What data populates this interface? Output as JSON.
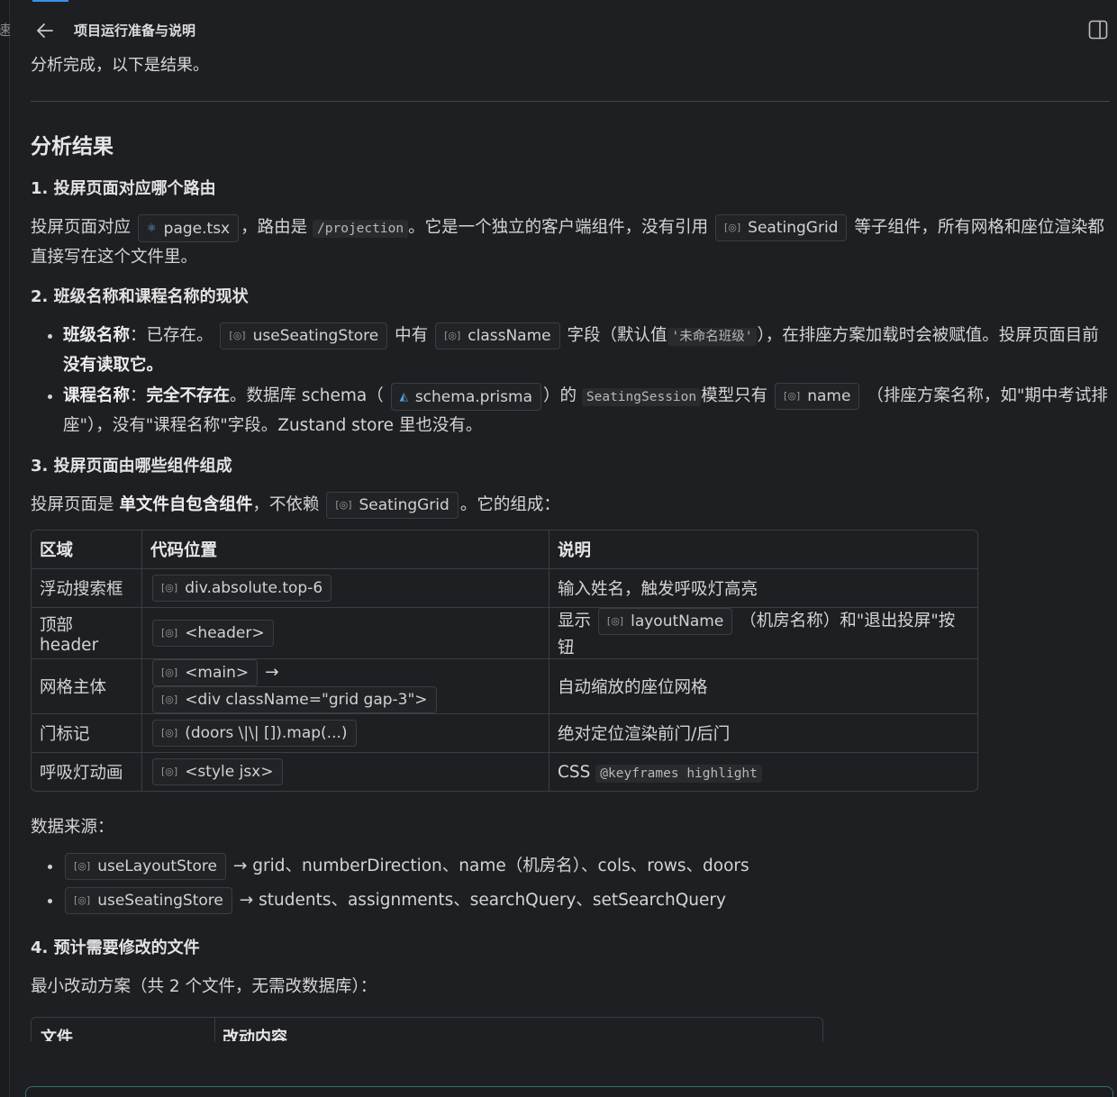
{
  "header": {
    "title": "项目运行准备与说明",
    "back_icon": "arrow-left-icon",
    "panel_icon": "panel-toggle-icon"
  },
  "gutter_glyph": "速",
  "intro": "分析完成，以下是结果。",
  "section_title": "分析结果",
  "q1": {
    "title": "1. 投屏页面对应哪个路由",
    "t1": "投屏页面对应",
    "chip_page": "page.tsx",
    "t2": "，路由是",
    "code_route": "/projection",
    "t3": "。它是一个独立的客户端组件，没有引用",
    "chip_grid": "SeatingGrid",
    "t4": "等子组件，所有网格和座位渲染都直接写在这个文件里。"
  },
  "q2": {
    "title": "2. 班级名称和课程名称的现状",
    "b1_label": "班级名称",
    "b1_t1": "：已存在。",
    "b1_chip1": "useSeatingStore",
    "b1_t2": "中有",
    "b1_chip2": "className",
    "b1_t3": "字段（默认值",
    "b1_code": "'未命名班级'",
    "b1_t4": "），在排座方案加载时会被赋值。投屏页面目前",
    "b1_bold": "没有读取它。",
    "b2_label": "课程名称",
    "b2_t1": "：",
    "b2_bold": "完全不存在",
    "b2_t2": "。数据库 schema（",
    "b2_chip1": "schema.prisma",
    "b2_t3": "）的",
    "b2_code": "SeatingSession",
    "b2_t4": "模型只有",
    "b2_chip2": "name",
    "b2_t5": "（排座方案名称，如\"期中考试排座\"），没有\"课程名称\"字段。Zustand store 里也没有。"
  },
  "q3": {
    "title": "3. 投屏页面由哪些组件组成",
    "t1": "投屏页面是",
    "bold": "单文件自包含组件",
    "t2": "，不依赖",
    "chip": "SeatingGrid",
    "t3": "。它的组成：",
    "table_headers": [
      "区域",
      "代码位置",
      "说明"
    ],
    "rows": [
      {
        "area": "浮动搜索框",
        "code1": "div.absolute.top-6",
        "desc": "输入姓名，触发呼吸灯高亮"
      },
      {
        "area": "顶部 header",
        "code1": "<header>",
        "desc_pre": "显示",
        "desc_chip": "layoutName",
        "desc_post": "（机房名称）和\"退出投屏\"按钮"
      },
      {
        "area": "网格主体",
        "code1": "<main>",
        "arrow": "→",
        "code2": "<div className=\"grid gap-3\">",
        "desc": "自动缩放的座位网格"
      },
      {
        "area": "门标记",
        "code1": "(doors \\|\\| []).map(...)",
        "desc": "绝对定位渲染前门/后门"
      },
      {
        "area": "呼吸灯动画",
        "code1": "<style jsx>",
        "desc_pre": "CSS",
        "desc_code": "@keyframes highlight"
      }
    ],
    "sources_label": "数据来源：",
    "sources": [
      {
        "chip": "useLayoutStore",
        "text": "→ grid、numberDirection、name（机房名）、cols、rows、doors"
      },
      {
        "chip": "useSeatingStore",
        "text": "→ students、assignments、searchQuery、setSearchQuery"
      }
    ]
  },
  "q4": {
    "title": "4. 预计需要修改的文件",
    "text": "最小改动方案（共 2 个文件，无需改数据库）：",
    "table_headers": [
      "文件",
      "改动内容"
    ]
  }
}
